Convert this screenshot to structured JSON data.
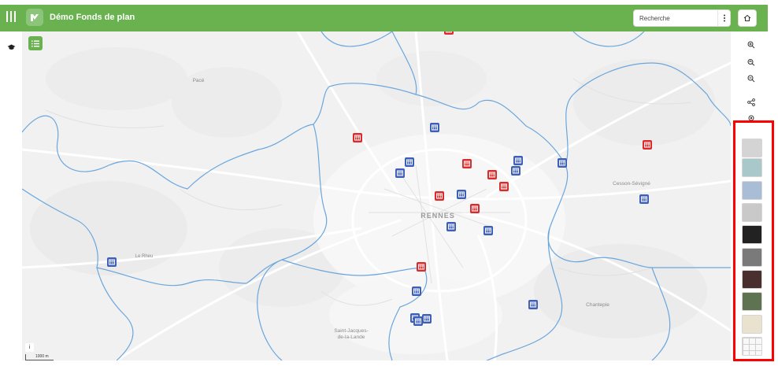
{
  "header": {
    "title": "Démo Fonds de plan",
    "search_placeholder": "Recherche"
  },
  "icons": {
    "menu": "menu-bars-icon",
    "logo": "app-logo-icon",
    "more": "more-vertical-icon",
    "home": "home-icon",
    "cap": "graduation-cap-icon",
    "list": "list-icon",
    "zoom_in": "zoom-in-icon",
    "zoom_home": "zoom-extent-icon",
    "zoom_out": "zoom-out-icon",
    "share": "share-icon",
    "locate": "locate-icon"
  },
  "colors": {
    "header": "#6ab150",
    "marker_red": "#d92b2b",
    "marker_blue": "#3d5fb8",
    "boundary": "#6aa6dc",
    "highlight_border": "#ff0000"
  },
  "map": {
    "place_labels": [
      {
        "text": "Pacé",
        "kind": "town"
      },
      {
        "text": "RENNES",
        "kind": "city"
      },
      {
        "text": "Le Rheu",
        "kind": "town"
      },
      {
        "text": "Cesson-Sévigné",
        "kind": "town"
      },
      {
        "text": "Chantepie",
        "kind": "town"
      },
      {
        "text": "Saint-Jacques-",
        "kind": "town"
      },
      {
        "text": "de-la-Lande",
        "kind": "town"
      }
    ],
    "attribution_label": "i",
    "scale_label": "1000 m"
  },
  "basemaps": [
    {
      "name": "light-grey-basemap",
      "color": "#d4d4d4"
    },
    {
      "name": "aerial-light-basemap",
      "color": "#a9c8c9"
    },
    {
      "name": "blue-relief-basemap",
      "color": "#a9bdd6"
    },
    {
      "name": "grey-plan-basemap",
      "color": "#c9c9c9"
    },
    {
      "name": "dark-basemap",
      "color": "#222222"
    },
    {
      "name": "grey-relief-basemap",
      "color": "#7a7a7a"
    },
    {
      "name": "dark-colored-basemap",
      "color": "#4a2f2f"
    },
    {
      "name": "satellite-basemap",
      "color": "#5e7352"
    },
    {
      "name": "street-basemap",
      "color": "#e8e2cf"
    },
    {
      "name": "grid-basemap",
      "color": "#f8f8f8"
    }
  ]
}
